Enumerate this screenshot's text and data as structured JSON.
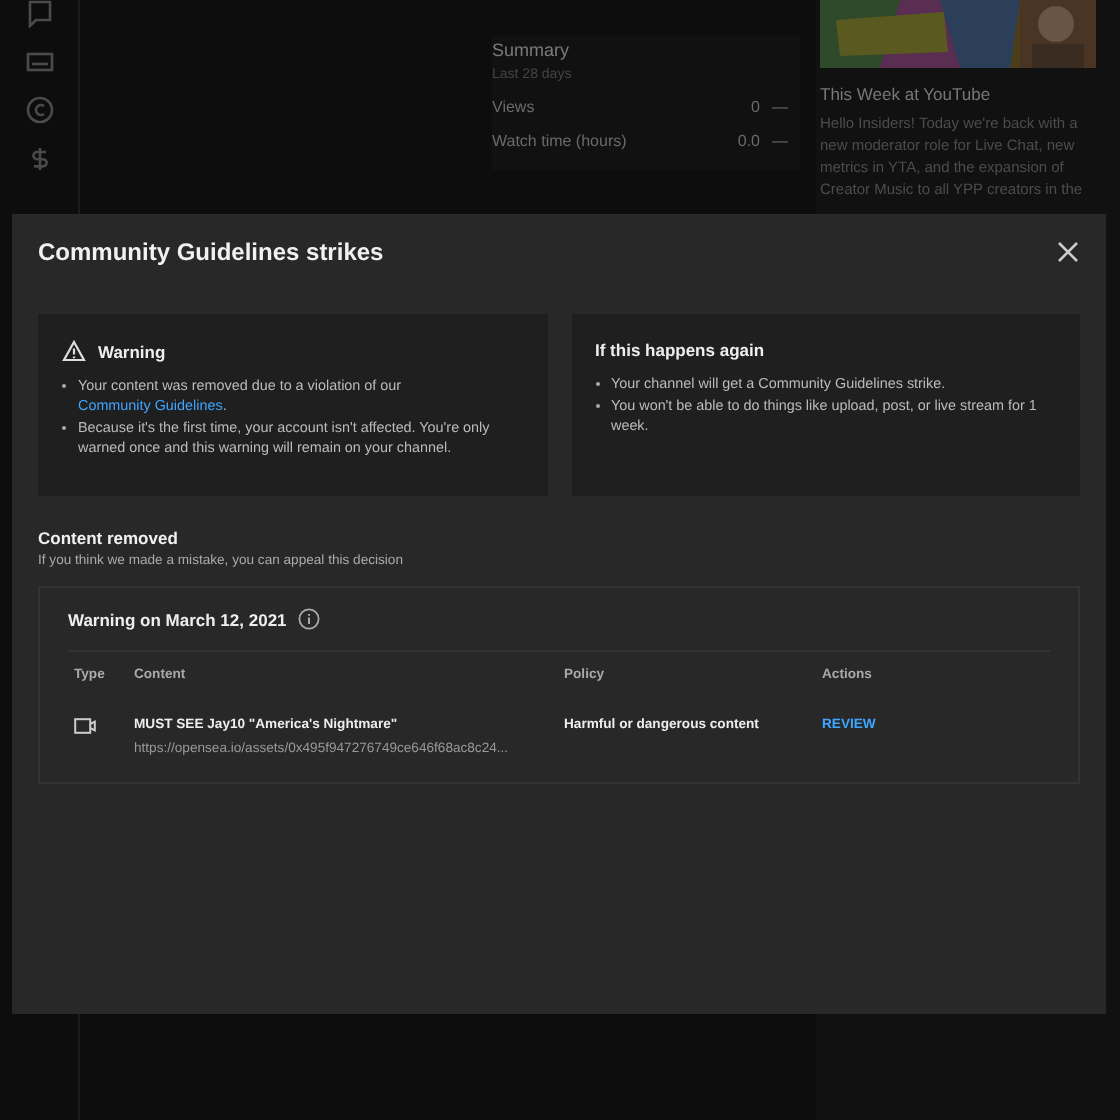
{
  "background": {
    "summary": {
      "title": "Summary",
      "subtitle": "Last 28 days",
      "metrics": [
        {
          "label": "Views",
          "value": "0",
          "trend": "—"
        },
        {
          "label": "Watch time (hours)",
          "value": "0.0",
          "trend": "—"
        }
      ]
    },
    "news": {
      "kind": "picture",
      "title": "This Week at YouTube",
      "text": "Hello Insiders! Today we're back with a new moderator role for Live Chat, new metrics in YTA, and the expansion of Creator Music to all YPP creators in the"
    }
  },
  "dialog": {
    "title": "Community Guidelines strikes",
    "cards": [
      {
        "kind": "warning",
        "title": "Warning",
        "bullets": [
          {
            "text": "Your content was removed due to a violation of our ",
            "link": "Community Guidelines",
            "after": "."
          },
          {
            "text": "Because it's the first time, your account isn't affected. You're only warned once and this warning will remain on your channel."
          }
        ]
      },
      {
        "kind": "plain",
        "title": "If this happens again",
        "bullets": [
          {
            "text": "Your channel will get a Community Guidelines strike."
          },
          {
            "text": "You won't be able to do things like upload, post, or live stream for 1 week."
          }
        ]
      }
    ],
    "section": {
      "title": "Content removed",
      "subtitle": "If you think we made a mistake, you can appeal this decision"
    },
    "warning": {
      "title": "Warning on March 12, 2021",
      "table": {
        "columns": [
          "Type",
          "Content",
          "Policy",
          "Actions"
        ],
        "rows": [
          {
            "kind": "video",
            "title": "MUST SEE Jay10 \"America's Nightmare\"",
            "url": "https://opensea.io/assets/0x495f947276749ce646f68ac8c24...",
            "policy": "Harmful or dangerous content",
            "action": "REVIEW"
          }
        ]
      }
    }
  }
}
